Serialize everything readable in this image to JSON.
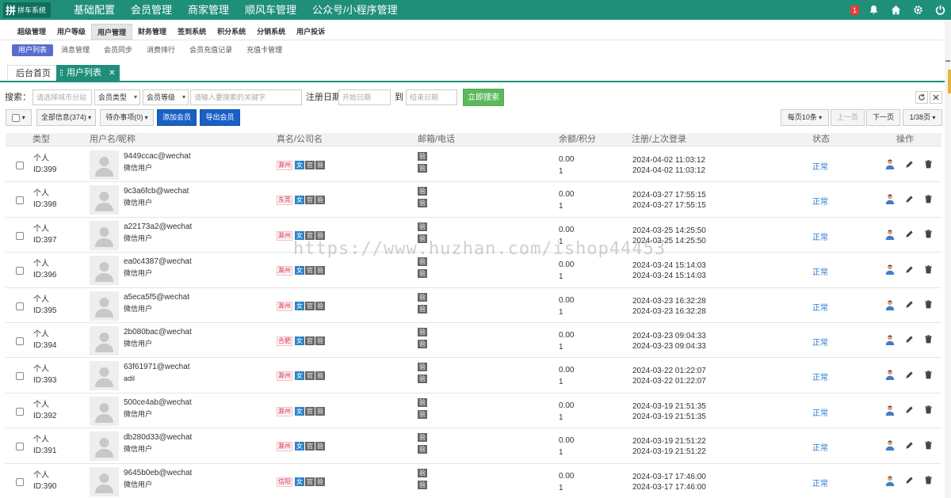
{
  "top": {
    "logo_mark": "拼",
    "logo_text": "拼车系统",
    "menus": [
      "基础配置",
      "会员管理",
      "商家管理",
      "顺风车管理",
      "公众号/小程序管理"
    ],
    "badge": "1"
  },
  "subnav": [
    "超级管理",
    "用户等级",
    "用户管理",
    "财务管理",
    "签到系统",
    "积分系统",
    "分销系统",
    "用户投诉"
  ],
  "thirdnav": [
    "用户列表",
    "消息管理",
    "会员同步",
    "消费排行",
    "会员充值记录",
    "充值卡管理"
  ],
  "pagetabs": {
    "home": "后台首页",
    "current": "用户列表",
    "close": "✕"
  },
  "search": {
    "label": "搜索：",
    "city_placeholder": "请选择城市分站",
    "member_type": "会员类型",
    "member_level": "会员等级",
    "keyword_placeholder": "请输入要搜索的关键字",
    "reg_label": "注册日期",
    "start_placeholder": "开始日期",
    "to": "到",
    "end_placeholder": "结束日期",
    "submit": "立即搜索"
  },
  "toolbar": {
    "all_info": "全部信息(374)",
    "todo": "待办事项(0)",
    "add": "添加会员",
    "export": "导出会员",
    "per_page": "每页10条",
    "prev": "上一页",
    "next": "下一页",
    "page": "1/38页"
  },
  "headers": [
    "类型",
    "用户名/昵称",
    "真名/公司名",
    "邮箱/电话",
    "余额/积分",
    "注册/上次登录",
    "状态",
    "操作"
  ],
  "rows": [
    {
      "type": "个人",
      "id": "ID:399",
      "name": "9449ccac@wechat",
      "nick": "微信用户",
      "city": "滁州",
      "balance": "0.00",
      "points": "1",
      "reg": "2024-04-02 11:03:12",
      "last": "2024-04-02 11:03:12",
      "status": "正常"
    },
    {
      "type": "个人",
      "id": "ID:398",
      "name": "9c3a6fcb@wechat",
      "nick": "微信用户",
      "city": "东莞",
      "balance": "0.00",
      "points": "1",
      "reg": "2024-03-27 17:55:15",
      "last": "2024-03-27 17:55:15",
      "status": "正常"
    },
    {
      "type": "个人",
      "id": "ID:397",
      "name": "a22173a2@wechat",
      "nick": "微信用户",
      "city": "滁州",
      "balance": "0.00",
      "points": "1",
      "reg": "2024-03-25 14:25:50",
      "last": "2024-03-25 14:25:50",
      "status": "正常"
    },
    {
      "type": "个人",
      "id": "ID:396",
      "name": "ea0c4387@wechat",
      "nick": "微信用户",
      "city": "滁州",
      "balance": "0.00",
      "points": "1",
      "reg": "2024-03-24 15:14:03",
      "last": "2024-03-24 15:14:03",
      "status": "正常"
    },
    {
      "type": "个人",
      "id": "ID:395",
      "name": "a5eca5f5@wechat",
      "nick": "微信用户",
      "city": "滁州",
      "balance": "0.00",
      "points": "1",
      "reg": "2024-03-23 16:32:28",
      "last": "2024-03-23 16:32:28",
      "status": "正常"
    },
    {
      "type": "个人",
      "id": "ID:394",
      "name": "2b080bac@wechat",
      "nick": "微信用户",
      "city": "合肥",
      "balance": "0.00",
      "points": "1",
      "reg": "2024-03-23 09:04:33",
      "last": "2024-03-23 09:04:33",
      "status": "正常"
    },
    {
      "type": "个人",
      "id": "ID:393",
      "name": "63f61971@wechat",
      "nick": "adil",
      "city": "滁州",
      "balance": "0.00",
      "points": "1",
      "reg": "2024-03-22 01:22:07",
      "last": "2024-03-22 01:22:07",
      "status": "正常"
    },
    {
      "type": "个人",
      "id": "ID:392",
      "name": "500ce4ab@wechat",
      "nick": "微信用户",
      "city": "滁州",
      "balance": "0.00",
      "points": "1",
      "reg": "2024-03-19 21:51:35",
      "last": "2024-03-19 21:51:35",
      "status": "正常"
    },
    {
      "type": "个人",
      "id": "ID:391",
      "name": "db280d33@wechat",
      "nick": "微信用户",
      "city": "滁州",
      "balance": "0.00",
      "points": "1",
      "reg": "2024-03-19 21:51:22",
      "last": "2024-03-19 21:51:22",
      "status": "正常"
    },
    {
      "type": "个人",
      "id": "ID:390",
      "name": "9645b0eb@wechat",
      "nick": "微信用户",
      "city": "信阳",
      "balance": "0.00",
      "points": "1",
      "reg": "2024-03-17 17:46:00",
      "last": "2024-03-17 17:46:00",
      "status": "正常"
    }
  ],
  "tag_labels": {
    "female": "女",
    "gov": "官",
    "verify": "验"
  },
  "watermark": "https://www.huzhan.com/ishop44453",
  "colors": {
    "primary": "#1f8f7a",
    "accent": "#1a5fc6",
    "success": "#5cb85c",
    "status": "#2b7ad1"
  }
}
